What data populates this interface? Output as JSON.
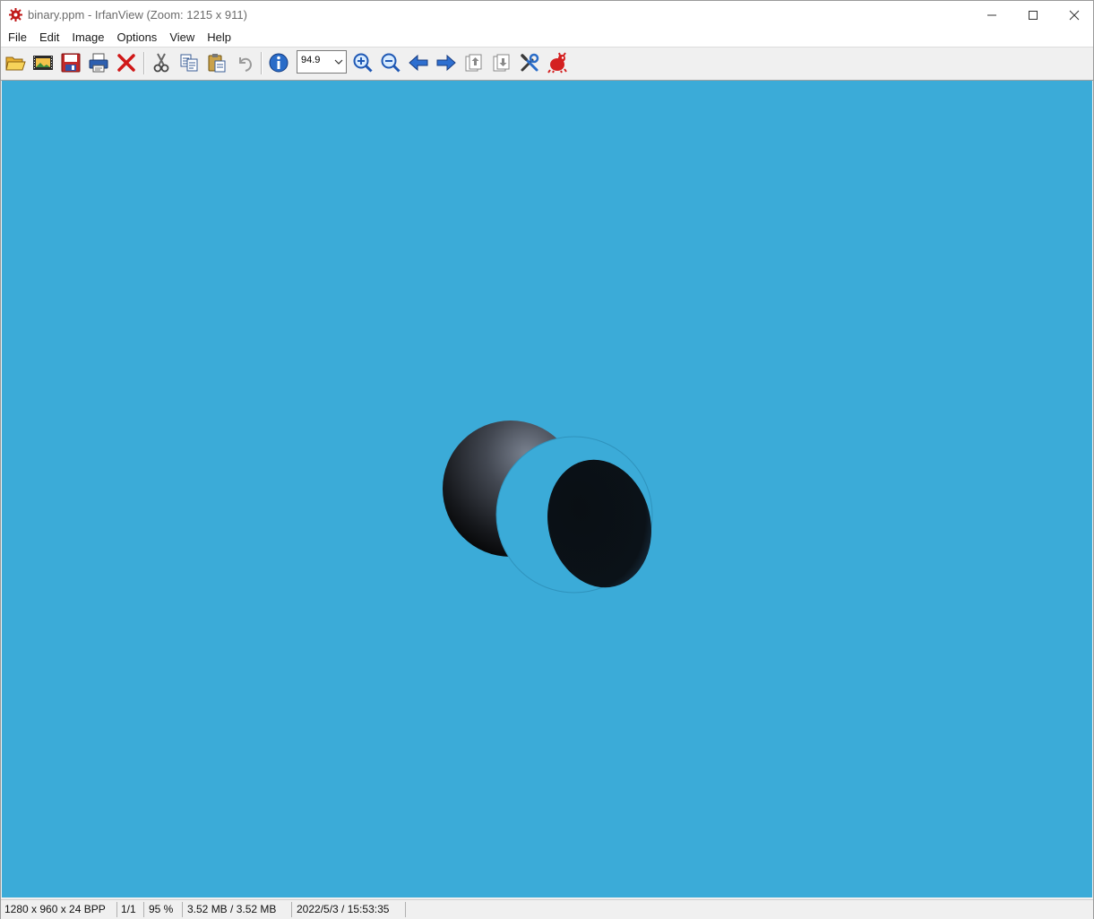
{
  "window": {
    "title": "binary.ppm - IrfanView (Zoom: 1215 x 911)"
  },
  "menu": {
    "items": [
      {
        "label": "File"
      },
      {
        "label": "Edit"
      },
      {
        "label": "Image"
      },
      {
        "label": "Options"
      },
      {
        "label": "View"
      },
      {
        "label": "Help"
      }
    ]
  },
  "toolbar": {
    "zoom_value": "94.9",
    "icons": [
      "open-folder-icon",
      "slideshow-icon",
      "save-icon",
      "print-icon",
      "delete-icon",
      "cut-icon",
      "copy-icon",
      "paste-icon",
      "undo-icon",
      "info-icon",
      "zoom-in-icon",
      "zoom-out-icon",
      "previous-icon",
      "next-icon",
      "page-up-icon",
      "page-down-icon",
      "settings-icon",
      "irfanview-logo-icon"
    ]
  },
  "status": {
    "dimensions": "1280 x 960 x 24 BPP",
    "index": "1/1",
    "zoom": "95 %",
    "size": "3.52 MB / 3.52 MB",
    "datetime": "2022/5/3 / 15:53:35"
  },
  "colors": {
    "canvas_background": "#3babd8",
    "sphere_dark": "#0b1218"
  }
}
